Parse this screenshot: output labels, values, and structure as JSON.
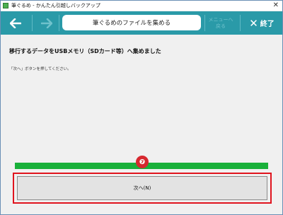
{
  "window": {
    "title": "筆ぐるめ - かんたん引越しバックアップ",
    "close_symbol": "✕"
  },
  "toolbar": {
    "back_icon": "arrow-left-icon",
    "forward_icon": "arrow-right-icon",
    "step_title": "筆ぐるめのファイルを集める",
    "menu_label": "メニューへ\n戻る",
    "exit_symbol": "✕",
    "exit_label": "終了"
  },
  "content": {
    "main_message": "移行するデータをUSBメモリ（SDカード等）へ集めました",
    "instruction": "「次へ」ボタンを押してください。"
  },
  "progress": {
    "value_fraction": 1.0,
    "fill_color": "#19b03a"
  },
  "annotation": {
    "badge": "❼",
    "highlight_color": "#e0141e"
  },
  "buttons": {
    "next_label": "次へ(N)"
  },
  "colors": {
    "toolbar_bg": "#2a9aa8"
  }
}
